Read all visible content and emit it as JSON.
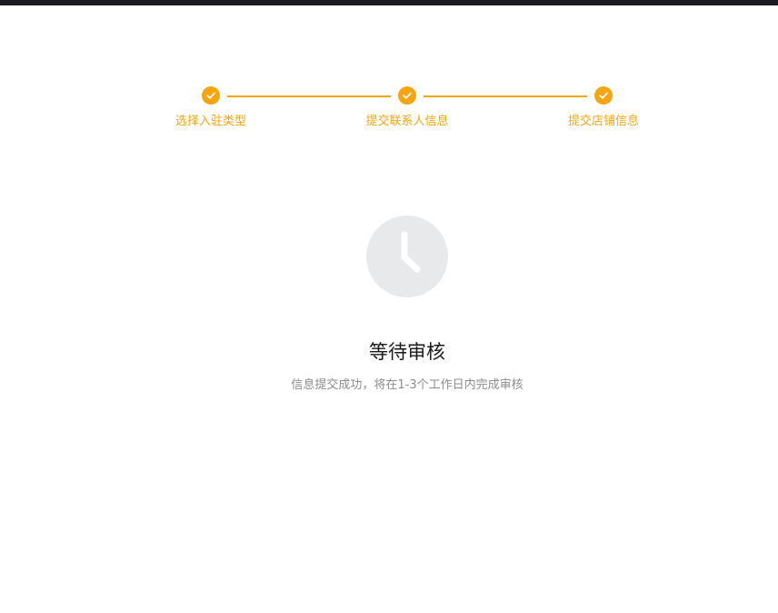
{
  "steps": [
    {
      "label": "选择入驻类型",
      "status": "completed",
      "icon": "check-icon"
    },
    {
      "label": "提交联系人信息",
      "status": "completed",
      "icon": "check-icon"
    },
    {
      "label": "提交店铺信息",
      "status": "completed",
      "icon": "check-icon"
    }
  ],
  "status": {
    "icon": "clock-icon",
    "title": "等待审核",
    "description": "信息提交成功，将在1-3个工作日内完成审核"
  },
  "colors": {
    "accent": "#f5a511",
    "topbar": "#1c1b24",
    "clock_bg": "#e8e9eb",
    "clock_hand": "#ffffff",
    "title": "#1a1a1a",
    "description": "#8c8c8c"
  }
}
